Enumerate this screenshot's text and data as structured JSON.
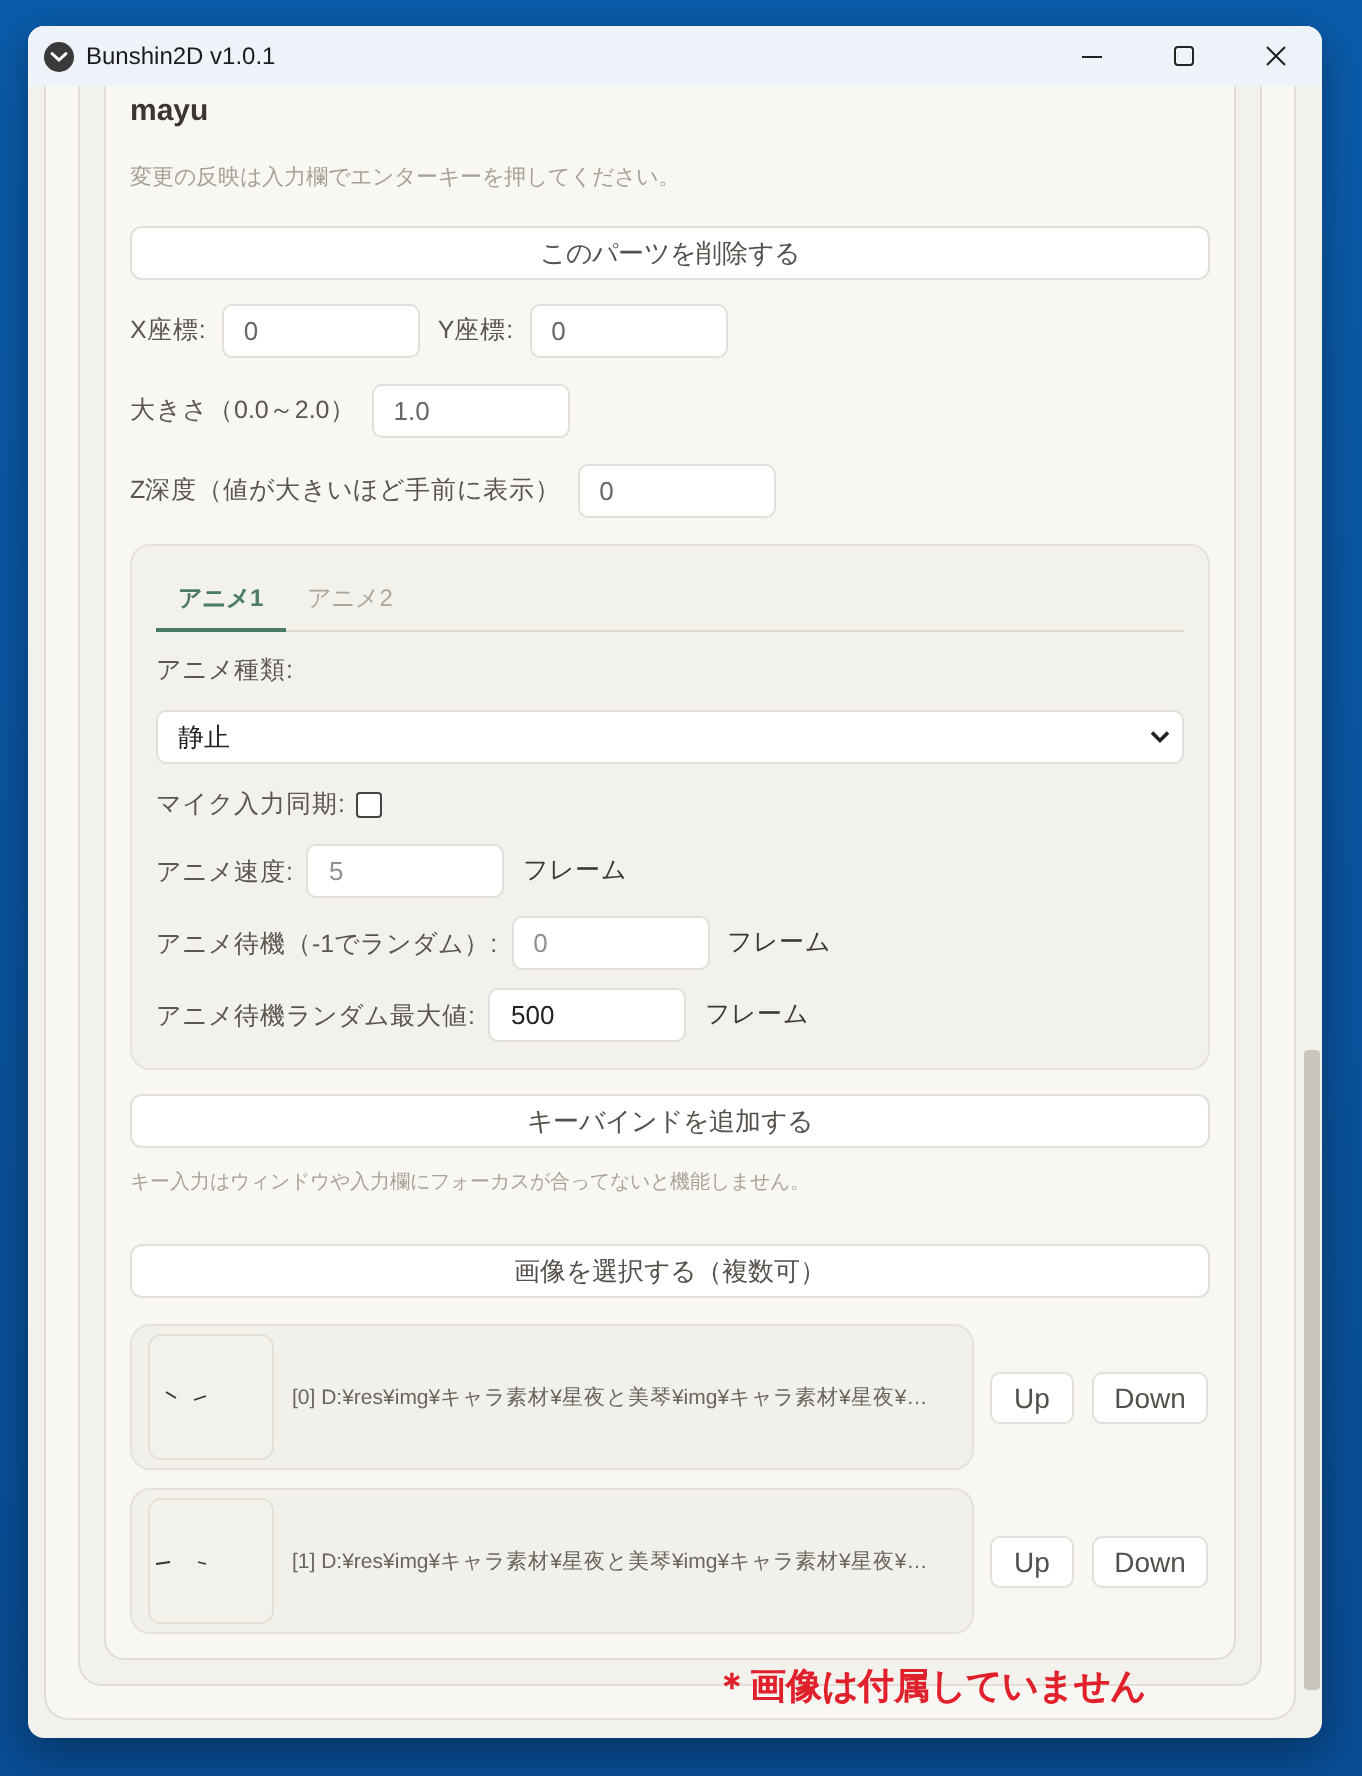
{
  "window": {
    "title": "Bunshin2D v1.0.1"
  },
  "part": {
    "name": "mayu",
    "hint": "変更の反映は入力欄でエンターキーを押してください。",
    "delete_button": "このパーツを削除する",
    "position_fields": [
      {
        "label": "X座標:",
        "value": "0"
      },
      {
        "label": "Y座標:",
        "value": "0"
      }
    ],
    "fields": [
      {
        "label": "大きさ（0.0～2.0）",
        "value": "1.0"
      },
      {
        "label": "Z深度（値が大きいほど手前に表示）",
        "value": "0"
      }
    ],
    "animation": {
      "tabs": [
        {
          "label": "アニメ1",
          "selected": true
        },
        {
          "label": "アニメ2",
          "selected": false
        }
      ],
      "type_label": "アニメ種類:",
      "type_value": "静止",
      "mic_sync": {
        "label": "マイク入力同期:",
        "checked": false
      },
      "fields": [
        {
          "label": "アニメ速度:",
          "placeholder": "5",
          "unit": "フレーム"
        },
        {
          "label": "アニメ待機（-1でランダム）:",
          "placeholder": "0",
          "unit": "フレーム"
        },
        {
          "label": "アニメ待機ランダム最大値:",
          "value": "500",
          "unit": "フレーム"
        }
      ]
    },
    "keybind_button": "キーバインドを追加する",
    "keybind_hint": "キー入力はウィンドウや入力欄にフォーカスが合ってないと機能しません。",
    "select_images_button": "画像を選択する（複数可）",
    "images": [
      {
        "path": "[0] D:¥res¥img¥キャラ素材¥星夜と美琴¥img¥キャラ素材¥星夜¥…",
        "up_button": "Up",
        "down_button": "Down"
      },
      {
        "path": "[1] D:¥res¥img¥キャラ素材¥星夜と美琴¥img¥キャラ素材¥星夜¥…",
        "up_button": "Up",
        "down_button": "Down"
      }
    ]
  },
  "annotation": "＊画像は付属していません"
}
